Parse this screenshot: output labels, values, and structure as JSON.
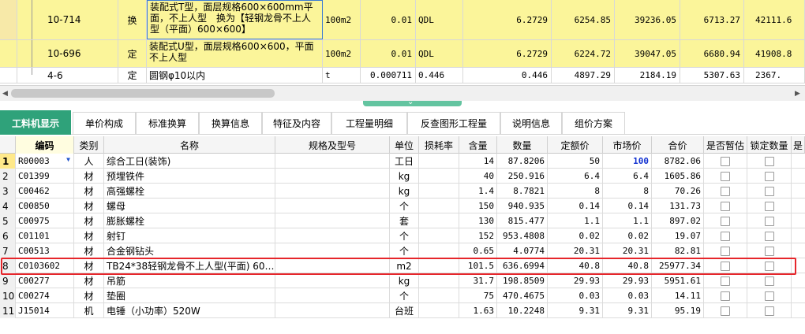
{
  "top_rows": [
    {
      "code": "10-714",
      "type": "换",
      "name": "装配式T型，面层规格600×600mm平面，不上人型　换为【轻钢龙骨不上人型（平面）600×600】",
      "unit": "100m2",
      "qty1": "0.01",
      "qty2": "QDL",
      "v1": "6.2729",
      "v2": "6254.85",
      "v3": "39236.05",
      "v4": "6713.27",
      "v5": "42111.6"
    },
    {
      "code": "10-696",
      "type": "定",
      "name": "装配式U型，面层规格600×600，平面不上人型",
      "unit": "100m2",
      "qty1": "0.01",
      "qty2": "QDL",
      "v1": "6.2729",
      "v2": "6224.72",
      "v3": "39047.05",
      "v4": "6680.94",
      "v5": "41908.8"
    },
    {
      "code": "4-6",
      "type": "定",
      "name": "圆钢φ10以内",
      "unit": "t",
      "qty1": "0.000711",
      "qty2": "0.446",
      "v1": "0.446",
      "v2": "4897.29",
      "v3": "2184.19",
      "v4": "5307.63",
      "v5": "2367."
    }
  ],
  "tabs": [
    "工料机显示",
    "单价构成",
    "标准换算",
    "换算信息",
    "特征及内容",
    "工程量明细",
    "反查图形工程量",
    "说明信息",
    "组价方案"
  ],
  "columns": [
    "编码",
    "类别",
    "名称",
    "规格及型号",
    "单位",
    "损耗率",
    "含量",
    "数量",
    "定额价",
    "市场价",
    "合价",
    "是否暂估",
    "锁定数量",
    "是"
  ],
  "rows": [
    {
      "n": "1",
      "code": "R00003",
      "cat": "人",
      "name": "综合工日(装饰)",
      "unit": "工日",
      "content": "14",
      "qty": "87.8206",
      "quota": "50",
      "market": "100",
      "total": "8782.06"
    },
    {
      "n": "2",
      "code": "C01399",
      "cat": "材",
      "name": "预埋铁件",
      "unit": "kg",
      "content": "40",
      "qty": "250.916",
      "quota": "6.4",
      "market": "6.4",
      "total": "1605.86"
    },
    {
      "n": "3",
      "code": "C00462",
      "cat": "材",
      "name": "高强螺栓",
      "unit": "kg",
      "content": "1.4",
      "qty": "8.7821",
      "quota": "8",
      "market": "8",
      "total": "70.26"
    },
    {
      "n": "4",
      "code": "C00850",
      "cat": "材",
      "name": "螺母",
      "unit": "个",
      "content": "150",
      "qty": "940.935",
      "quota": "0.14",
      "market": "0.14",
      "total": "131.73"
    },
    {
      "n": "5",
      "code": "C00975",
      "cat": "材",
      "name": "膨胀螺栓",
      "unit": "套",
      "content": "130",
      "qty": "815.477",
      "quota": "1.1",
      "market": "1.1",
      "total": "897.02"
    },
    {
      "n": "6",
      "code": "C01101",
      "cat": "材",
      "name": "射钉",
      "unit": "个",
      "content": "152",
      "qty": "953.4808",
      "quota": "0.02",
      "market": "0.02",
      "total": "19.07"
    },
    {
      "n": "7",
      "code": "C00513",
      "cat": "材",
      "name": "合金钢钻头",
      "unit": "个",
      "content": "0.65",
      "qty": "4.0774",
      "quota": "20.31",
      "market": "20.31",
      "total": "82.81"
    },
    {
      "n": "8",
      "code": "C0103602",
      "cat": "材",
      "name": "TB24*38轻钢龙骨不上人型(平面) 60…",
      "unit": "m2",
      "content": "101.5",
      "qty": "636.6994",
      "quota": "40.8",
      "market": "40.8",
      "total": "25977.34"
    },
    {
      "n": "9",
      "code": "C00277",
      "cat": "材",
      "name": "吊筋",
      "unit": "kg",
      "content": "31.7",
      "qty": "198.8509",
      "quota": "29.93",
      "market": "29.93",
      "total": "5951.61"
    },
    {
      "n": "10",
      "code": "C00274",
      "cat": "材",
      "name": "垫圈",
      "unit": "个",
      "content": "75",
      "qty": "470.4675",
      "quota": "0.03",
      "market": "0.03",
      "total": "14.11"
    },
    {
      "n": "11",
      "code": "J15014",
      "cat": "机",
      "name": "电锤（小功率）520W",
      "unit": "台班",
      "content": "1.63",
      "qty": "10.2248",
      "quota": "9.31",
      "market": "9.31",
      "total": "95.19"
    }
  ],
  "colors": {
    "tab_active": "#2fa27a",
    "row_yellow": "#fbf59a",
    "highlight_border": "#e6262b",
    "market_blue": "#1030d0"
  }
}
